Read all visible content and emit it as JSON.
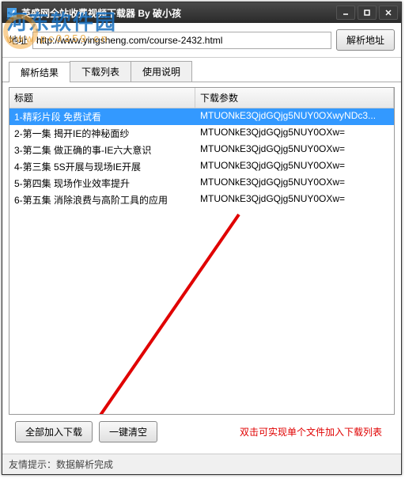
{
  "window": {
    "title": "英盛网全站收费视频下载器 By 破小孩"
  },
  "address": {
    "label": "地址",
    "value": "http://www.yingsheng.com/course-2432.html",
    "parse_btn": "解析地址"
  },
  "tabs": [
    "解析结果",
    "下载列表",
    "使用说明"
  ],
  "columns": {
    "title": "标题",
    "param": "下载参数"
  },
  "rows": [
    {
      "title": "1-精彩片段 免费试看",
      "param": "MTUONkE3QjdGQjg5NUY0OXwyNDc3..."
    },
    {
      "title": "2-第一集 揭开IE的神秘面纱",
      "param": "MTUONkE3QjdGQjg5NUY0OXw="
    },
    {
      "title": "3-第二集 做正确的事-IE六大意识",
      "param": "MTUONkE3QjdGQjg5NUY0OXw="
    },
    {
      "title": "4-第三集 5S开展与现场IE开展",
      "param": "MTUONkE3QjdGQjg5NUY0OXw="
    },
    {
      "title": "5-第四集 现场作业效率提升",
      "param": "MTUONkE3QjdGQjg5NUY0OXw="
    },
    {
      "title": "6-第五集 消除浪费与高阶工具的应用",
      "param": "MTUONkE3QjdGQjg5NUY0OXw="
    }
  ],
  "buttons": {
    "add_all": "全部加入下载",
    "clear_all": "一键清空"
  },
  "hint": "双击可实现单个文件加入下载列表",
  "status": "友情提示：数据解析完成",
  "watermark": {
    "main": "河东软件园",
    "sub": "www.pc0359.cn"
  }
}
